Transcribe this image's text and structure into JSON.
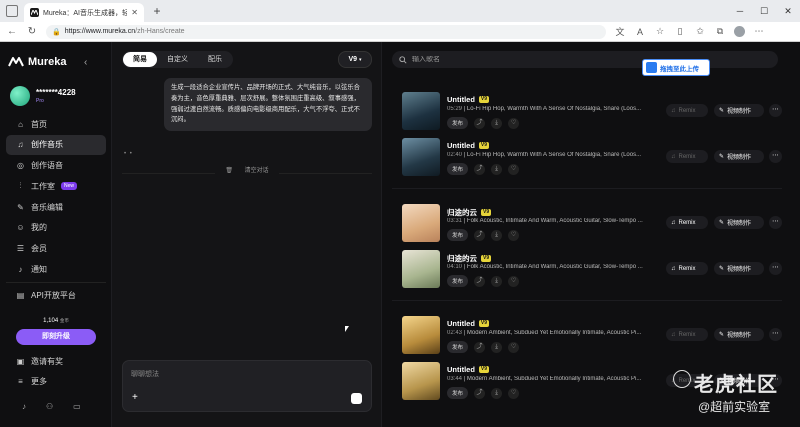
{
  "browser": {
    "tab_title": "Mureka：AI音乐生成器，轻松创作",
    "url_host": "https://www.mureka.cn",
    "url_path": "/zh-Hans/create"
  },
  "sidebar": {
    "brand": "Mureka",
    "username": "*******4228",
    "plan": "Pro",
    "items": [
      {
        "label": "首页",
        "icon": "home-icon"
      },
      {
        "label": "创作音乐",
        "icon": "music-note-icon"
      },
      {
        "label": "创作语音",
        "icon": "microphone-icon"
      },
      {
        "label": "工作室",
        "icon": "waveform-icon",
        "badge": "New"
      },
      {
        "label": "音乐编辑",
        "icon": "edit-icon"
      },
      {
        "label": "我的",
        "icon": "user-icon"
      },
      {
        "label": "会员",
        "icon": "database-icon"
      },
      {
        "label": "通知",
        "icon": "bell-icon"
      }
    ],
    "api": "API开放平台",
    "credits": "1,104",
    "credits_unit": "金币",
    "upgrade": "即刻升级",
    "invite": "邀请有奖",
    "more": "更多"
  },
  "chat": {
    "modes": [
      "简易",
      "自定义",
      "配乐"
    ],
    "model": "V9",
    "prompt_text": "生成一段适合企业宣传片、品牌开场的正式、大气纯音乐，以弦乐合奏为主，音色厚重典雅、层次舒展。整体氛围庄重高级、叙事感强，强弱过渡自然流畅。质感偏向电影级商用配乐，大气不浮夸、正式不沉闷。",
    "clear": "清空对话",
    "input_placeholder": "聊聊想法"
  },
  "right": {
    "search_placeholder": "输入歌名",
    "drop_upload": "拖拽至此上传",
    "remix_label": "Remix",
    "video_label": "视频制作",
    "publish_label": "发布",
    "songs": [
      {
        "title": "Untitled",
        "badge": "V9",
        "duration": "05:29",
        "desc": "Lo-Fi Hip Hop, Warmth With A Sense Of Nostalgia, Snare (Loos...",
        "remix_enabled": false
      },
      {
        "title": "Untitled",
        "badge": "V9",
        "duration": "02:40",
        "desc": "Lo-Fi Hip Hop, Warmth With A Sense Of Nostalgia, Snare (Loos...",
        "remix_enabled": false
      },
      {
        "title": "归途的云",
        "badge": "V9",
        "duration": "03:31",
        "desc": "Folk Acoustic, Intimate And Warm, Acoustic Guitar, Slow-Tempo ...",
        "remix_enabled": true
      },
      {
        "title": "归途的云",
        "badge": "V9",
        "duration": "04:10",
        "desc": "Folk Acoustic, Intimate And Warm, Acoustic Guitar, Slow-Tempo ...",
        "remix_enabled": true
      },
      {
        "title": "Untitled",
        "badge": "V9",
        "duration": "02:43",
        "desc": "Modern Ambient, Subdued Yet Emotionally Intimate, Acoustic Pi...",
        "remix_enabled": false
      },
      {
        "title": "Untitled",
        "badge": "V9",
        "duration": "03:44",
        "desc": "Modern Ambient, Subdued Yet Emotionally Intimate, Acoustic Pi...",
        "remix_enabled": false
      }
    ]
  },
  "watermark": {
    "line1": "老虎社区",
    "line2": "@超前实验室"
  }
}
